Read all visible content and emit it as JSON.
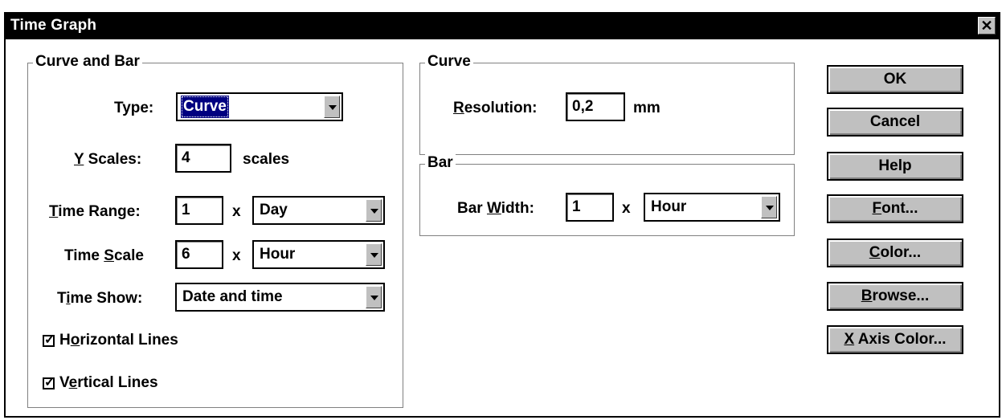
{
  "window": {
    "title": "Time Graph",
    "close_glyph": "✕"
  },
  "curve_and_bar": {
    "legend": "Curve and Bar",
    "type_label": "Type:",
    "type_value": "Curve",
    "y_scales_pre": "",
    "y_scales_key": "Y",
    "y_scales_rest": " Scales:",
    "y_scales_value": "4",
    "y_scales_unit": "scales",
    "time_range_key": "T",
    "time_range_rest": "ime Range:",
    "time_range_value": "1",
    "time_range_x": "x",
    "time_range_unit": "Day",
    "time_scale_pre": "Time ",
    "time_scale_key": "S",
    "time_scale_rest": "cale",
    "time_scale_value": "6",
    "time_scale_x": "x",
    "time_scale_unit": "Hour",
    "time_show_pre": "T",
    "time_show_key": "i",
    "time_show_rest": "me Show:",
    "time_show_value": "Date and time",
    "horizontal_pre": "H",
    "horizontal_key": "o",
    "horizontal_rest": "rizontal Lines",
    "horizontal_checked": true,
    "vertical_pre": "V",
    "vertical_key": "e",
    "vertical_rest": "rtical Lines",
    "vertical_checked": true
  },
  "curve": {
    "legend": "Curve",
    "resolution_key": "R",
    "resolution_rest": "esolution:",
    "resolution_value": "0,2",
    "resolution_unit": "mm"
  },
  "bar": {
    "legend": "Bar",
    "width_pre": "Bar ",
    "width_key": "W",
    "width_rest": "idth:",
    "width_value": "1",
    "width_x": "x",
    "width_unit": "Hour"
  },
  "buttons": {
    "ok": "OK",
    "cancel": "Cancel",
    "help": "Help",
    "font_key": "F",
    "font_rest": "ont...",
    "color_key": "C",
    "color_rest": "olor...",
    "browse_key": "B",
    "browse_rest": "rowse...",
    "xaxis_key": "X",
    "xaxis_rest": " Axis Color..."
  }
}
